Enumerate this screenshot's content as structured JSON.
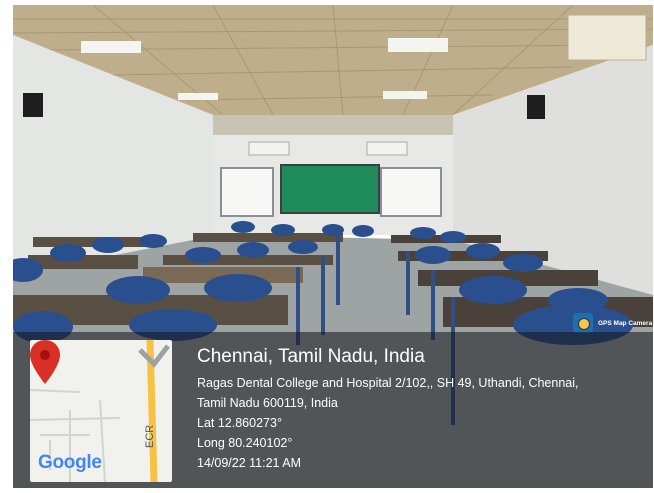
{
  "location": {
    "title": "Chennai, Tamil Nadu, India",
    "address_line1": "Ragas Dental College and Hospital 2/102,, SH 49, Uthandi, Chennai,",
    "address_line2": "Tamil Nadu 600119, India",
    "latitude": "Lat 12.860273°",
    "longitude": "Long 80.240102°",
    "datetime": "14/09/22 11:21 AM"
  },
  "map": {
    "logo_text": "Google",
    "road_label": "ECR",
    "pin_color": "#d93025",
    "road_color": "#f6c244"
  },
  "app_badge": {
    "name": "GPS Map Camera",
    "icon": "camera-globe-icon"
  },
  "scene": {
    "board_color": "#1f8a5a",
    "desk_color": "#7a6a55",
    "chair_color": "#2a4f8f"
  }
}
